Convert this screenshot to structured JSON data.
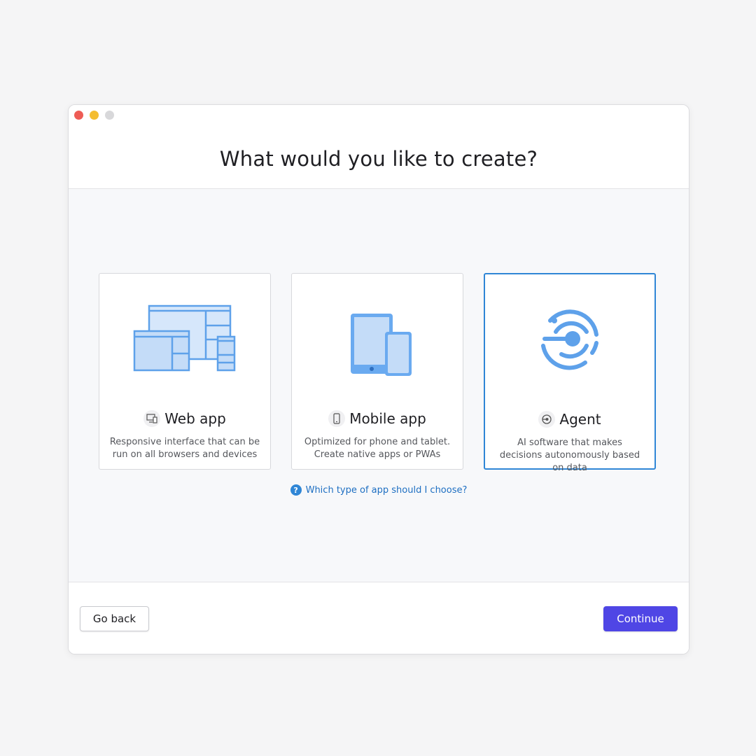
{
  "window": {
    "traffic_lights": {
      "close": "#ee5c55",
      "minimize": "#f4bd32",
      "zoom": "#d8d8da"
    }
  },
  "header": {
    "title": "What would you like to create?"
  },
  "cards": [
    {
      "id": "web",
      "name": "Web app",
      "icon": "devices-icon",
      "description": "Responsive interface that can be run on all browsers and devices",
      "selected": false
    },
    {
      "id": "mobile",
      "name": "Mobile app",
      "icon": "phone-icon",
      "description": "Optimized for phone and tablet. Create native apps or PWAs",
      "selected": false
    },
    {
      "id": "agent",
      "name": "Agent",
      "icon": "agent-icon",
      "description": "AI software that makes decisions autonomously based on data",
      "selected": true
    }
  ],
  "help": {
    "icon": "help-icon",
    "label": "Which type of app should I choose?"
  },
  "footer": {
    "back_label": "Go back",
    "continue_label": "Continue"
  },
  "colors": {
    "accent": "#4f46e5",
    "selected_border": "#2f86d6",
    "illustration": "#5ea1ea",
    "illustration_fill": "#c4dcf8",
    "link": "#1e6fc2"
  }
}
